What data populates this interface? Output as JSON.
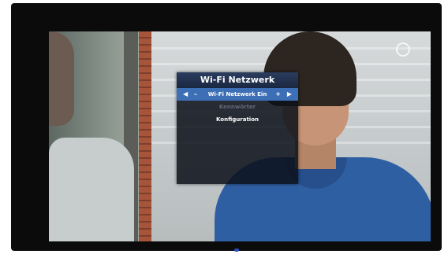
{
  "menu": {
    "title": "Wi-Fi Netzwerk",
    "items": [
      {
        "label": "Wi-Fi Netzwerk Ein",
        "state": "selected"
      },
      {
        "label": "Kennwörter",
        "state": "disabled"
      },
      {
        "label": "Konfiguration",
        "state": "normal"
      }
    ]
  },
  "icons": {
    "left_arrow": "◀",
    "left_minus": "–",
    "right_plus": "+",
    "right_arrow": "▶"
  },
  "colors": {
    "selection": "#3c6fb6",
    "menu_background": "#0c101a",
    "led": "#2c4eb8"
  }
}
